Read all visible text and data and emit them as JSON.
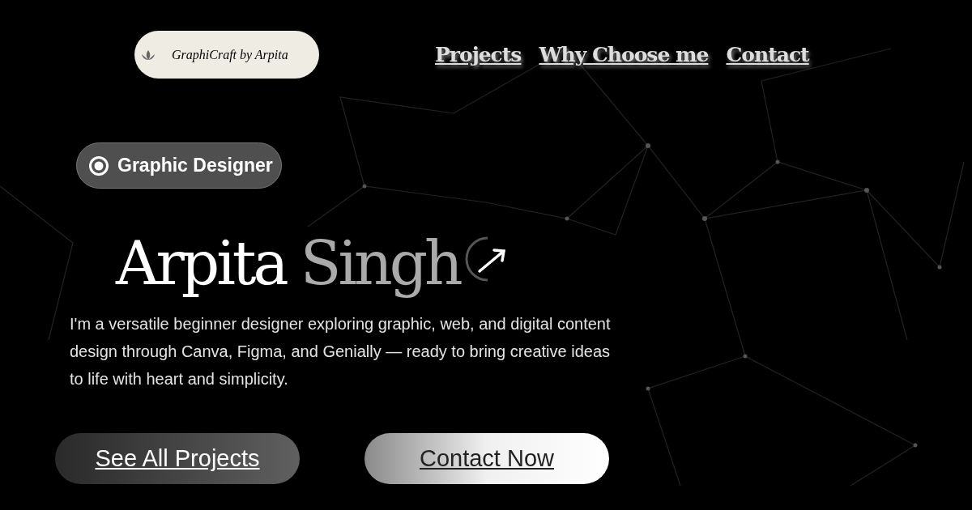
{
  "logo": {
    "text": "GraphiCraft by Arpita"
  },
  "nav": [
    {
      "label": "Projects"
    },
    {
      "label": "Why Choose me"
    },
    {
      "label": "Contact"
    }
  ],
  "badge": {
    "label": "Graphic Designer"
  },
  "hero": {
    "first_name": "Arpita",
    "last_name": "Singh",
    "description": "I'm a versatile beginner designer exploring graphic, web, and digital content design through Canva, Figma, and Genially — ready to bring creative ideas to life with heart and simplicity."
  },
  "buttons": [
    {
      "label": "See All Projects",
      "kind": "dark"
    },
    {
      "label": "Contact Now",
      "kind": "light"
    }
  ]
}
